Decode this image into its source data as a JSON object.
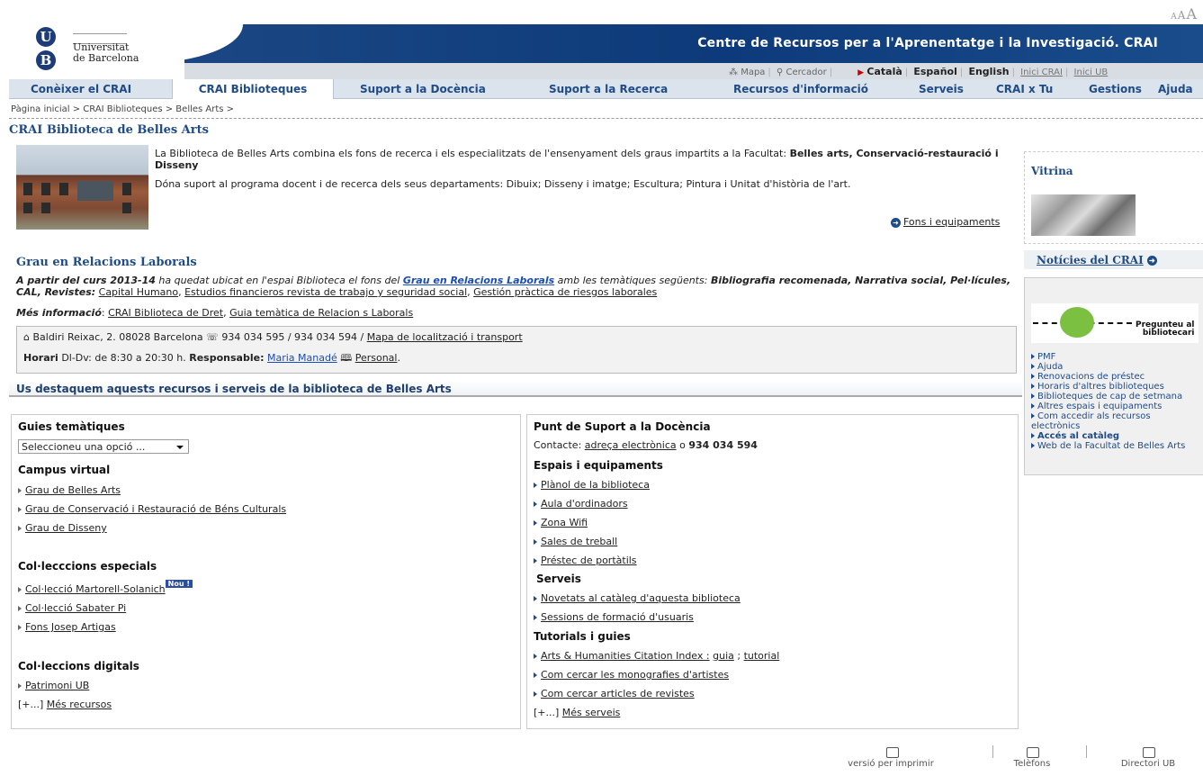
{
  "header": {
    "font_sizer": [
      "A",
      "A",
      "A"
    ],
    "ub_logo_letters": [
      "U",
      "B"
    ],
    "ub_name_line1": "Universitat",
    "ub_name_line2": "de Barcelona",
    "site_title": "Centre de Recursos per a l'Aprenentatge i la Investigació. CRAI",
    "utility": {
      "mapa": "Mapa",
      "cercador": "Cercador",
      "catala": "Català",
      "espanol": "Español",
      "english": "English",
      "inici_crai": "Inici CRAI",
      "inici_ub": "Inici UB"
    }
  },
  "nav": [
    {
      "label": "Conèixer el CRAI"
    },
    {
      "label": "CRAI Biblioteques",
      "active": true
    },
    {
      "label": "Suport a la Docència"
    },
    {
      "label": "Suport a la Recerca"
    },
    {
      "label": "Recursos d'informació"
    },
    {
      "label": "Serveis"
    },
    {
      "label": "CRAI x Tu"
    },
    {
      "label": "Gestions"
    },
    {
      "label": "Ajuda"
    }
  ],
  "breadcrumb": "Pàgina inicial > CRAI Biblioteques > Belles Arts >",
  "page_title": "CRAI Biblioteca de Belles Arts",
  "intro": {
    "p1_plain": "La Biblioteca de Belles Arts combina els fons de recerca i els especialitzats de l'ensenyament dels graus impartits a la Facultat: ",
    "p1_bold": "Belles arts, Conservació-restauració i Disseny",
    "p2": "Dóna suport al programa docent i de recerca dels seus departaments: Dibuix; Disseny i imatge; Escultura; Pintura i Unitat d'història de l'art.",
    "fons_link": "Fons i equipaments"
  },
  "grau": {
    "title": "Grau en Relacions Laborals",
    "t1": "A partir del curs 2013-14",
    "t2": " ha quedat ubicat en l'espai Biblioteca el fons del ",
    "t3": "Grau en Relacions Laborals",
    "t4": " amb les temàtiques següents: ",
    "t5": "Bibliografia recomenada, Narrativa social, Pel·lícules, CAL, Revistes:",
    "l1": "Capital Humano",
    "l2": "Estudios financieros revista de trabajo y seguridad social",
    "l3": "Gestión pràctica de riesgos laborales",
    "mes_info_label": "Més informació",
    "mes_info_l1": "CRAI Biblioteca de Dret",
    "mes_info_l2": "Guia temàtica de Relacion s Laborals"
  },
  "contact": {
    "address": "Baldiri Reixac, 2. 08028 Barcelona",
    "phones": "934 034 595 / 934 034 594 /",
    "map_link": "Mapa de localització i transport",
    "horari_label": "Horari",
    "horari_value": "Dl-Dv: de 8:30 a 20:30 h.",
    "responsable_label": "Responsable:",
    "responsable_name": "Maria Manadé",
    "personal": "Personal"
  },
  "destaquem": "Us destaquem aquests recursos i serveis de la biblioteca de Belles Arts",
  "left_panel": {
    "guies_title": "Guies temàtiques",
    "select_value": "Seleccioneu una opció ...",
    "campus_title": "Campus virtual",
    "campus_links": [
      "Grau de Belles Arts",
      "Grau de Conservació i Restauració de Béns Culturals",
      "Grau de Disseny"
    ],
    "col_esp_title": "Col·lecccions especials",
    "col_esp_links": [
      "Col·lecció Martorell-Solanich",
      "Col·lecció Sabater Pi",
      "Fons Josep Artigas"
    ],
    "nou_badge": "Nou !",
    "col_dig_title": "Col·leccions digitals",
    "col_dig_links": [
      "Patrimoni UB"
    ],
    "more_prefix": "[+...]",
    "more_link": "Més recursos"
  },
  "right_panel": {
    "psd_title": "Punt de Suport a la Docència",
    "contacte_label": "Contacte:",
    "contacte_link": "adreça electrònica",
    "contacte_o": "o",
    "contacte_phone": "934 034 594",
    "espais_title": "Espais i equipaments",
    "espais_links": [
      "Plànol de la biblioteca",
      "Aula d'ordinadors",
      "Zona Wifi",
      "Sales de treball",
      "Préstec de portàtils"
    ],
    "serveis_title": "Serveis",
    "serveis_links": [
      "Novetats al catàleg d'aquesta biblioteca",
      "Sessions de formació d'usuaris"
    ],
    "tutorials_title": "Tutorials i guies",
    "ahci": "Arts & Humanities Citation Index :",
    "guia": "guia",
    "tutorial": "tutorial",
    "tut_links": [
      "Com cercar les monografies d'artistes",
      "Com cercar articles de revistes"
    ],
    "more_prefix": "[+...]",
    "more_link": "Més serveis"
  },
  "sidebar": {
    "vitrina": "Vitrina",
    "noticies": "Notícies del CRAI",
    "preg_line1": "Pregunteu al",
    "preg_line2": "bibliotecari",
    "links": [
      "PMF",
      "Ajuda",
      "Renovacions de préstec",
      "Horaris d'altres biblioteques",
      "Biblioteques de cap de setmana",
      "Altres espais i equipaments",
      "Com accedir als recursos electrònics",
      "Accés al catàleg",
      "Web de la Facultat de Belles Arts"
    ]
  },
  "footer": {
    "print": "versió per imprimir",
    "telefons": "Telèfons",
    "directori": "Directori UB"
  }
}
